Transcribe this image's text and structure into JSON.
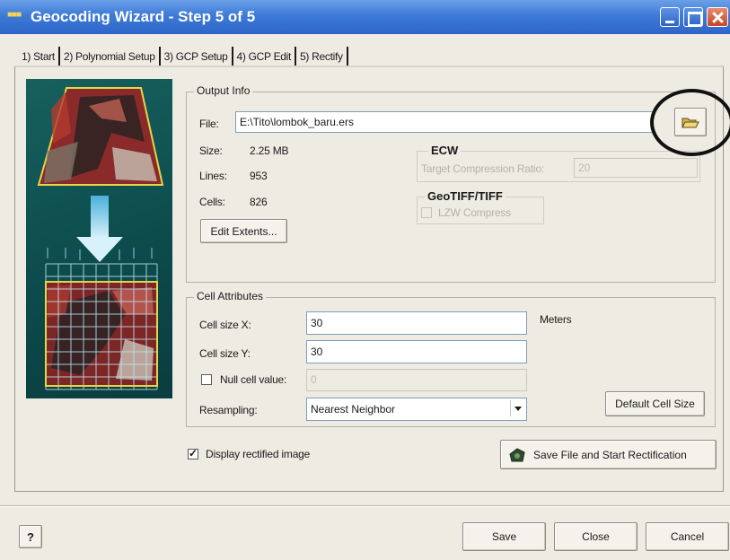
{
  "window": {
    "title": "Geocoding Wizard - Step 5 of 5"
  },
  "tabs": [
    {
      "label": "1) Start"
    },
    {
      "label": "2) Polynomial Setup"
    },
    {
      "label": "3) GCP Setup"
    },
    {
      "label": "4) GCP Edit"
    },
    {
      "label": "5) Rectify",
      "active": true
    }
  ],
  "output_info": {
    "group_label": "Output Info",
    "file_label": "File:",
    "file_value": "E:\\Tito\\lombok_baru.ers",
    "size_label": "Size:",
    "size_value": "2.25  MB",
    "lines_label": "Lines:",
    "lines_value": "953",
    "cells_label": "Cells:",
    "cells_value": "826",
    "edit_extents_label": "Edit Extents...",
    "ecw": {
      "group_label": "ECW",
      "compression_label": "Target Compression Ratio:",
      "compression_value": "20"
    },
    "geotiff": {
      "group_label": "GeoTIFF/TIFF",
      "lzw_label": "LZW Compress"
    }
  },
  "cell_attributes": {
    "group_label": "Cell Attributes",
    "cell_size_x_label": "Cell size X:",
    "cell_size_x_value": "30",
    "units_label": "Meters",
    "cell_size_y_label": "Cell size Y:",
    "cell_size_y_value": "30",
    "null_cell_label": "Null cell value:",
    "null_cell_value": "0",
    "resampling_label": "Resampling:",
    "resampling_value": "Nearest Neighbor",
    "default_cell_size_label": "Default Cell Size"
  },
  "display_rectified": {
    "label": "Display rectified image",
    "checked": true
  },
  "save_start_label": "Save File and Start Rectification",
  "footer": {
    "save_label": "Save",
    "close_label": "Close",
    "cancel_label": "Cancel"
  },
  "colors": {
    "titlebar": "#3d7ad6",
    "window_bg": "#eeebe2",
    "preview_bg": "#0c4a4b",
    "footprint_border": "#e8d447",
    "arrow": "#a9d9f0"
  },
  "icons": {
    "app": "app-logo-icon",
    "browse": "open-folder-icon",
    "save_start": "save-disk-icon",
    "help": "help-icon"
  }
}
